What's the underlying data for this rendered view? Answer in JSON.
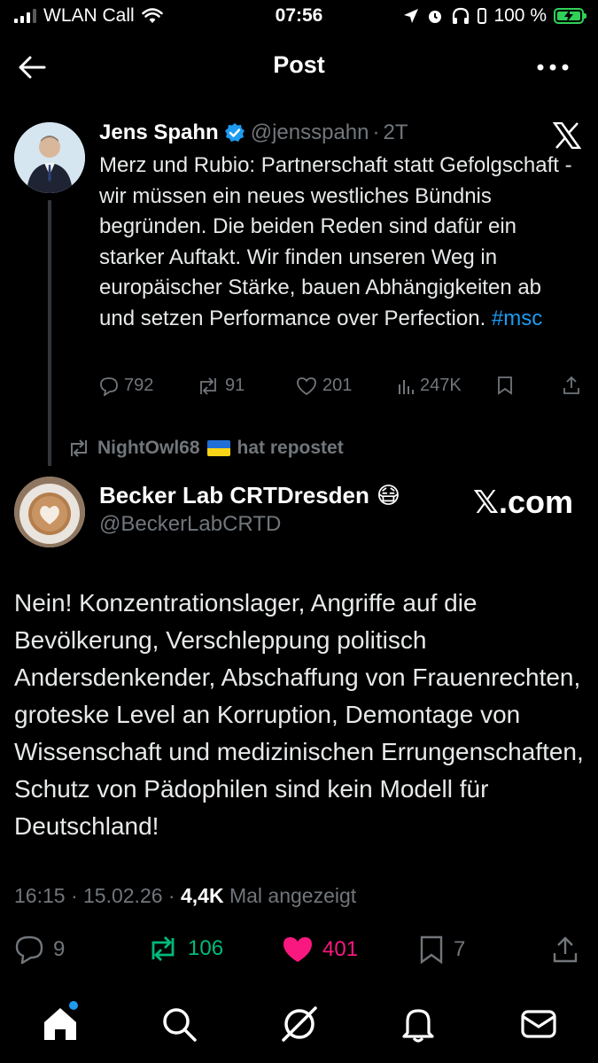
{
  "status_bar": {
    "carrier": "WLAN Call",
    "time": "07:56",
    "battery": "100 %",
    "battery_level": 1.0
  },
  "header": {
    "title": "Post",
    "back_icon": "arrow-left-icon",
    "more_icon": "ellipsis-icon"
  },
  "quoted_tweet": {
    "name": "Jens Spahn",
    "handle": "@jensspahn",
    "time": "2T",
    "verified_icon": "verified-badge-icon",
    "text": "Merz und Rubio: Partnerschaft statt Gefolgschaft - wir müssen ein neues westliches Bündnis begründen. Die beiden Reden sind dafür ein starker Auftakt. Wir finden unseren Weg in europäischer Stärke, bauen Abhängigkeiten ab und setzen Performance over Perfection.",
    "hashtag": "#msc",
    "replies": "792",
    "reposts": "91",
    "likes": "201",
    "views": "247K"
  },
  "repost_notice": {
    "user": "NightOwl68",
    "label": "hat repostet"
  },
  "main_tweet": {
    "name": "Becker Lab CRTDresden",
    "emoji": "😷",
    "handle": "@BeckerLabCRTD",
    "watermark": "𝕏.com",
    "text": "Nein! Konzentrationslager, Angriffe auf die Bevölkerung, Verschleppung politisch Andersdenkender, Abschaffung von Frauenrechten, groteske Level an Korruption, Demontage von Wissenschaft und medizinischen Errungenschaften, Schutz von Pädophilen sind kein Modell für Deutschland!",
    "timestamp": "16:15 · 15.02.26 · ",
    "views_count": "4,4K",
    "views_label": " Mal angezeigt",
    "replies": "9",
    "reposts": "106",
    "likes": "401",
    "bookmarks": "7"
  },
  "colors": {
    "background": "#000000",
    "link": "#1d9bf0",
    "repost_green": "#00ba7c",
    "like_pink": "#f91880",
    "muted": "#71767b"
  },
  "tab_bar": [
    "home-icon",
    "search-icon",
    "grok-icon",
    "notifications-icon",
    "messages-icon"
  ]
}
